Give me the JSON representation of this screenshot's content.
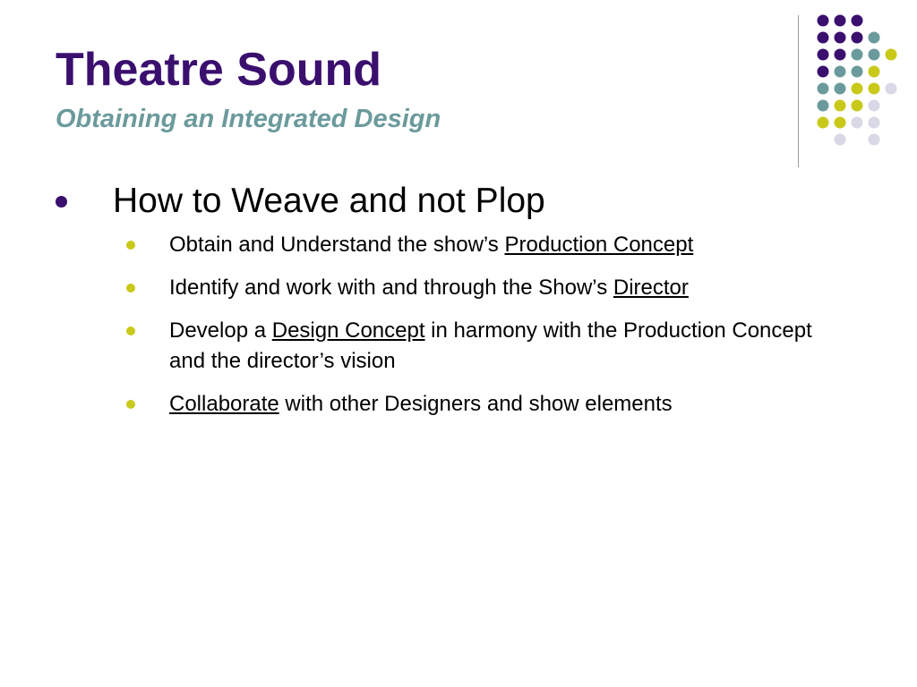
{
  "slide": {
    "title": "Theatre Sound",
    "subtitle": "Obtaining an Integrated Design",
    "main_bullet": "How to Weave and not Plop",
    "sub_bullets": [
      {
        "before": "Obtain and Understand the show’s ",
        "link": "Production Concept",
        "after": ""
      },
      {
        "before": "Identify and work with and through the Show’s ",
        "link": "Director",
        "after": ""
      },
      {
        "before": "Develop a ",
        "link": "Design Concept",
        "after": " in harmony with the Production Concept and the director’s vision"
      },
      {
        "before": "",
        "link": "Collaborate",
        "after": " with other Designers and show elements"
      }
    ]
  },
  "colors": {
    "purple": "#3a0f6e",
    "teal": "#6b9a9c",
    "olive": "#c9c91a",
    "lavender": "#d8d8e6"
  }
}
